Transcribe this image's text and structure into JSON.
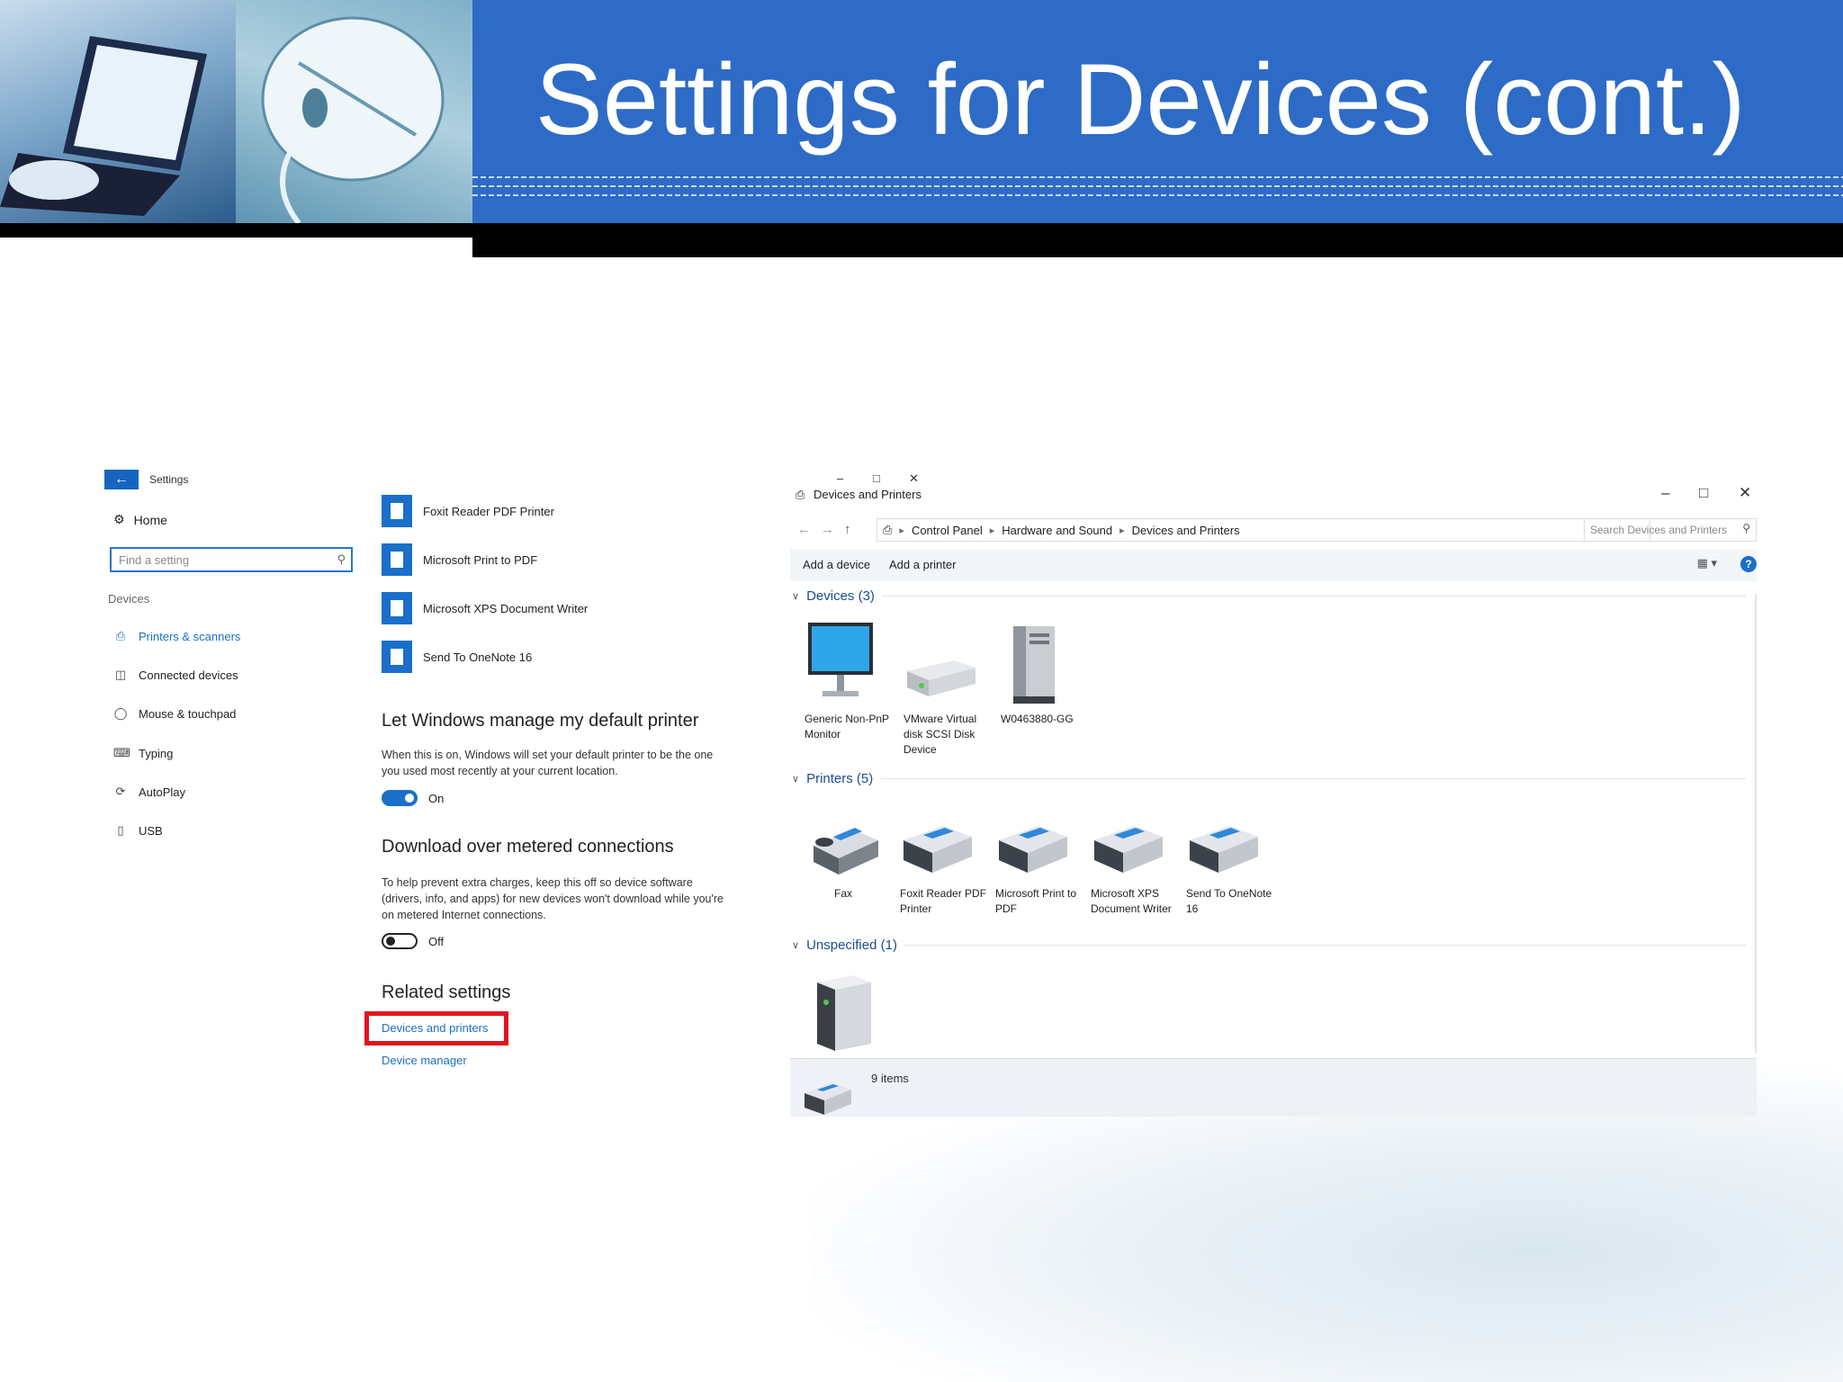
{
  "slide": {
    "title": "Settings for Devices (cont.)"
  },
  "settings": {
    "app_title": "Settings",
    "back_icon": "arrow-left-icon",
    "home_label": "Home",
    "search_placeholder": "Find a setting",
    "section_label": "Devices",
    "nav_items": [
      {
        "label": "Printers & scanners",
        "icon": "printer-icon",
        "active": true
      },
      {
        "label": "Connected devices",
        "icon": "devices-icon",
        "active": false
      },
      {
        "label": "Mouse & touchpad",
        "icon": "mouse-icon",
        "active": false
      },
      {
        "label": "Typing",
        "icon": "keyboard-icon",
        "active": false
      },
      {
        "label": "AutoPlay",
        "icon": "autoplay-icon",
        "active": false
      },
      {
        "label": "USB",
        "icon": "usb-icon",
        "active": false
      }
    ],
    "printers": [
      "Foxit Reader PDF Printer",
      "Microsoft Print to PDF",
      "Microsoft XPS Document Writer",
      "Send To OneNote 16"
    ],
    "default_printer": {
      "heading": "Let Windows manage my default printer",
      "description": "When this is on, Windows will set your default printer to be the one you used most recently at your current location.",
      "toggle_label": "On"
    },
    "metered": {
      "heading": "Download over metered connections",
      "description": "To help prevent extra charges, keep this off so device software (drivers, info, and apps) for new devices won't download while you're on metered Internet connections.",
      "toggle_label": "Off"
    },
    "related": {
      "heading": "Related settings",
      "link_devices": "Devices and printers",
      "link_manager": "Device manager"
    },
    "highlight_color": "#e0141e",
    "accent_color": "#1a6fc9"
  },
  "devices_window": {
    "title": "Devices and Printers",
    "breadcrumb": [
      "Control Panel",
      "Hardware and Sound",
      "Devices and Printers"
    ],
    "search_placeholder": "Search Devices and Printers",
    "toolbar": {
      "add_device": "Add a device",
      "add_printer": "Add a printer"
    },
    "groups": {
      "devices": "Devices (3)",
      "printers": "Printers (5)",
      "unspecified": "Unspecified (1)"
    },
    "devices": [
      {
        "label": "Generic Non-PnP\nMonitor",
        "icon": "monitor-icon"
      },
      {
        "label": "VMware Virtual\ndisk SCSI Disk\nDevice",
        "icon": "disk-drive-icon"
      },
      {
        "label": "W0463880-GG",
        "icon": "computer-tower-icon"
      }
    ],
    "printers": [
      {
        "label": "Fax",
        "icon": "fax-icon"
      },
      {
        "label": "Foxit Reader PDF\nPrinter",
        "icon": "printer-icon"
      },
      {
        "label": "Microsoft Print to\nPDF",
        "icon": "printer-icon"
      },
      {
        "label": "Microsoft XPS\nDocument Writer",
        "icon": "printer-icon"
      },
      {
        "label": "Send To OneNote\n16",
        "icon": "printer-icon"
      }
    ],
    "unspecified": [
      {
        "label": "",
        "icon": "server-icon"
      }
    ],
    "status": "9 items"
  }
}
